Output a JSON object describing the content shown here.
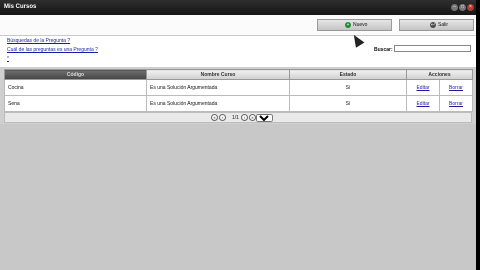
{
  "window": {
    "title": "Mis Cursos"
  },
  "toolbar": {
    "new_label": "Nuevo",
    "exit_label": "Salir"
  },
  "links": {
    "search_help": "Búsquedas de la Pregunta ?",
    "choose_question": "Cuál de las preguntas es una Pregunta ?",
    "asterisk": "*"
  },
  "search": {
    "label": "Buscar:",
    "value": ""
  },
  "table": {
    "headers": [
      "Código",
      "Nombre Curso",
      "Estado",
      "Acciones"
    ],
    "rows": [
      {
        "code": "Cocina",
        "name": "Es una Solución Argumentada",
        "status": "Sí",
        "edit": "Editar",
        "delete": "Borrar"
      },
      {
        "code": "Sena",
        "name": "Es una Solución Argumentada",
        "status": "Sí",
        "edit": "Editar",
        "delete": "Borrar"
      }
    ]
  },
  "pager": {
    "info": "1/1",
    "page_size": "10"
  },
  "colors": {
    "titlebar": "#1f1f1f",
    "selected_header": "#555555",
    "link": "#1a1aa6",
    "add_icon": "#1c8a2e",
    "exit_icon": "#4a4a4a"
  },
  "icons": {
    "add": "plus-circle-icon",
    "exit": "exit-icon"
  }
}
